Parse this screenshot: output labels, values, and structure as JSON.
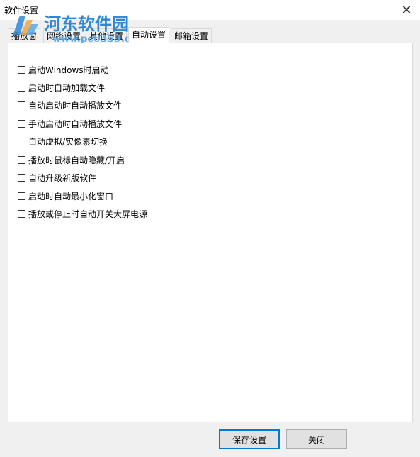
{
  "window": {
    "title": "软件设置",
    "close_glyph": "✕"
  },
  "watermark": {
    "site_name": "河东软件园",
    "url": "www.pc0359.cn"
  },
  "tabs": [
    {
      "label": "播放窗"
    },
    {
      "label": "网络设置"
    },
    {
      "label": "其他设置"
    },
    {
      "label": "自动设置",
      "active": true
    },
    {
      "label": "邮箱设置"
    }
  ],
  "options": [
    {
      "label": "启动Windows时启动",
      "checked": false
    },
    {
      "label": "启动时自动加载文件",
      "checked": false
    },
    {
      "label": "自动启动时自动播放文件",
      "checked": false
    },
    {
      "label": "手动启动时自动播放文件",
      "checked": false
    },
    {
      "label": "自动虚拟/实像素切换",
      "checked": false
    },
    {
      "label": "播放时鼠标自动隐藏/开启",
      "checked": false
    },
    {
      "label": "自动升级新版软件",
      "checked": false
    },
    {
      "label": "启动时自动最小化窗口",
      "checked": false
    },
    {
      "label": "播放或停止时自动开关大屏电源",
      "checked": false
    }
  ],
  "buttons": {
    "save": "保存设置",
    "close": "关闭"
  },
  "colors": {
    "accent": "#0078d7",
    "watermark": "#2f88d6",
    "background": "#f0f0f0",
    "panel": "#ffffff"
  }
}
